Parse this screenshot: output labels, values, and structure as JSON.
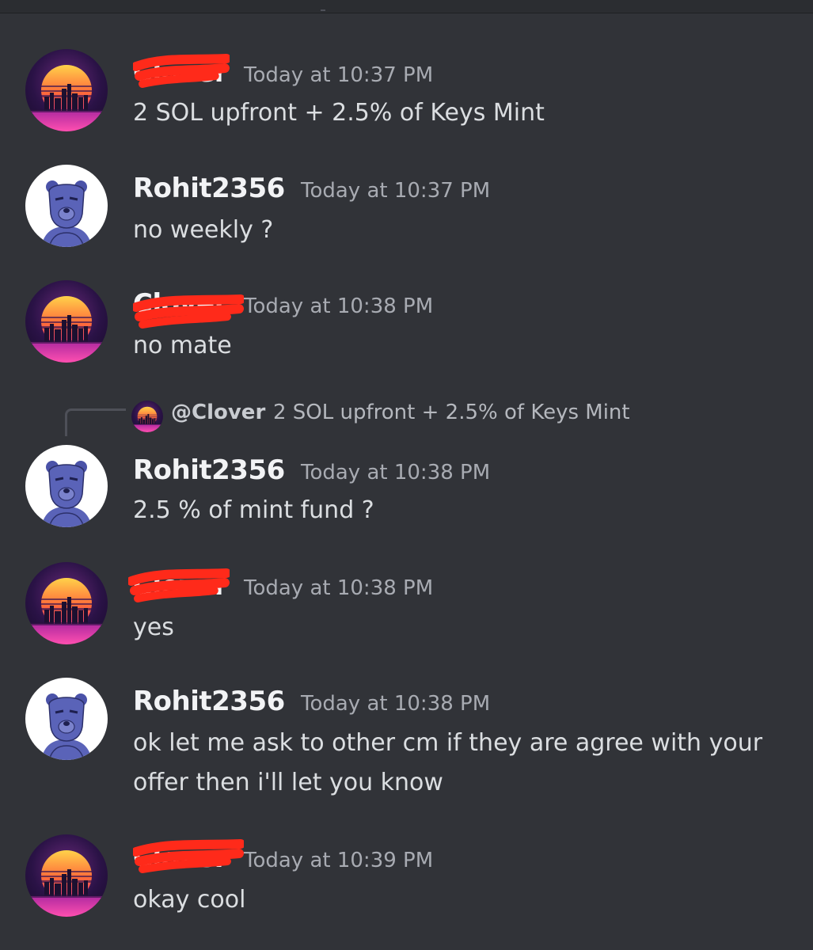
{
  "messages": [
    {
      "author": "Clover",
      "timestamp": "Today at 10:37 PM",
      "lines": [
        "2 SOL upfront + 2.5% of Keys Mint"
      ],
      "avatar": "synthwave-city-avatar",
      "redacted": true
    },
    {
      "author": "Rohit2356",
      "timestamp": "Today at 10:37 PM",
      "lines": [
        "no weekly ?"
      ],
      "avatar": "bear-avatar",
      "redacted": false
    },
    {
      "author": "Clover",
      "timestamp": "Today at 10:38 PM",
      "lines": [
        "no mate"
      ],
      "avatar": "synthwave-city-avatar",
      "redacted": true
    },
    {
      "author": "Rohit2356",
      "timestamp": "Today at 10:38 PM",
      "lines": [
        "2.5 % of mint fund ?"
      ],
      "avatar": "bear-avatar",
      "redacted": false,
      "reply_to": {
        "author": "@Clover",
        "text": "2 SOL upfront + 2.5% of Keys Mint"
      }
    },
    {
      "author": "Clover",
      "timestamp": "Today at 10:38 PM",
      "lines": [
        "yes"
      ],
      "avatar": "synthwave-city-avatar",
      "redacted": true
    },
    {
      "author": "Rohit2356",
      "timestamp": "Today at 10:38 PM",
      "lines": [
        "ok let me ask to other cm if they are agree with your",
        "offer then i'll let you know"
      ],
      "avatar": "bear-avatar",
      "redacted": false
    },
    {
      "author": "Clover",
      "timestamp": "Today at 10:39 PM",
      "lines": [
        "okay cool"
      ],
      "avatar": "synthwave-city-avatar",
      "redacted": true
    }
  ],
  "colors": {
    "background": "#313338",
    "author": "#f2f3f5",
    "timestamp": "#a8abb2",
    "text": "#dbdee1",
    "redaction": "#ff2a1a"
  }
}
